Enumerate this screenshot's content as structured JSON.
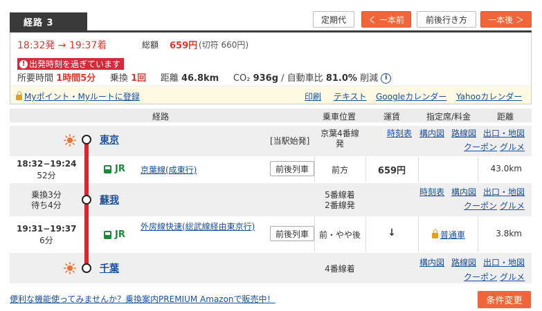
{
  "header": {
    "route_tab": "経路 3",
    "pass_button": "定期代",
    "prev_button": "く 一本前",
    "around_button": "前後行き方",
    "next_button": "一本後 ＞"
  },
  "summary": {
    "time": "18:32発 → 19:37着",
    "fare_label": "総額",
    "fare": "659円",
    "ticket_fare": "(切符 660円)",
    "warning": "出発時刻を過ぎています",
    "duration_label": "所要時間",
    "duration": "1時間5分",
    "transfer_label": "乗換",
    "transfers": "1回",
    "distance_label": "距離",
    "distance": "46.8km",
    "co2_label": "CO₂",
    "co2": "936g",
    "co2_ratio_label": "/ 自動車比",
    "co2_ratio": "81.0%",
    "co2_suffix": "削減",
    "info_icon": "i"
  },
  "links": {
    "myroute": "Myポイント・Myルートに登録",
    "print": "印刷",
    "text": "テキスト",
    "google": "Googleカレンダー",
    "yahoo": "Yahooカレンダー"
  },
  "table_header": {
    "route": "経路",
    "position": "乗車位置",
    "fare": "運賃",
    "reserved": "指定席/料金",
    "distance": "距離"
  },
  "rows": {
    "tokyo": {
      "name": "東京",
      "note": "[当駅始発]",
      "platform": "京葉4番線\n発",
      "links": [
        "時刻表",
        "構内図",
        "路線図",
        "出口・地図",
        "クーポン",
        "グルメ"
      ]
    },
    "seg1": {
      "time": "18:32−19:24",
      "duration": "52分",
      "operator": "JR",
      "line": "京葉線(成東行)",
      "around": "前後列車",
      "position": "前方",
      "fare": "659円",
      "distance": "43.0km"
    },
    "soga": {
      "transfer": "乗換3分",
      "wait": "待ち4分",
      "name": "蘇我",
      "platform_in": "5番線着",
      "platform_out": "2番線発",
      "links": [
        "時刻表",
        "構内図",
        "路線図",
        "出口・地図",
        "クーポン",
        "グルメ"
      ]
    },
    "seg2": {
      "time": "19:31−19:37",
      "duration": "6分",
      "operator": "JR",
      "line": "外房線快速(総武線経由東京行)",
      "around": "前後列車",
      "position": "前・やや後",
      "fare": "↓",
      "reserved": "普通車",
      "distance": "3.8km"
    },
    "chiba": {
      "name": "千葉",
      "platform": "4番線着",
      "links": [
        "構内図",
        "路線図",
        "出口・地図",
        "クーポン",
        "グルメ"
      ]
    }
  },
  "footer": {
    "premium": "便利な機能使ってみませんか？乗換案内PREMIUM Amazonで販売中！",
    "conditions": "条件変更"
  },
  "colors": {
    "accent": "#f0663a",
    "red": "#e0382e",
    "line": "#e0242e"
  }
}
